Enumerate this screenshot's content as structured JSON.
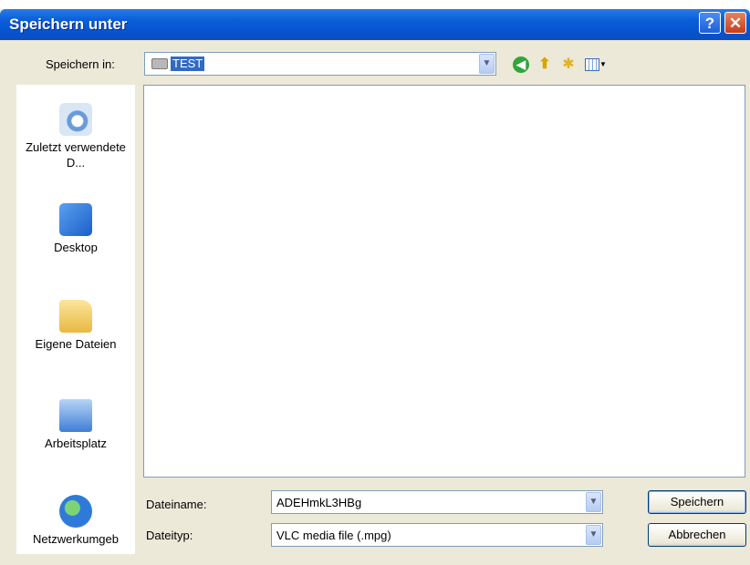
{
  "window": {
    "title": "Speichern unter",
    "help_label": "?",
    "close_label": "✕"
  },
  "toolbar": {
    "look_in_label": "Speichern in:",
    "look_in_value": "TEST",
    "icons": [
      "back-icon",
      "up-folder-icon",
      "new-folder-icon",
      "views-menu-icon"
    ]
  },
  "places": [
    {
      "label": "Zuletzt verwendete D...",
      "icon": "recent-documents-icon"
    },
    {
      "label": "Desktop",
      "icon": "desktop-icon"
    },
    {
      "label": "Eigene Dateien",
      "icon": "my-documents-icon"
    },
    {
      "label": "Arbeitsplatz",
      "icon": "my-computer-icon"
    },
    {
      "label": "Netzwerkumgeb",
      "icon": "network-icon"
    }
  ],
  "form": {
    "filename_label": "Dateiname:",
    "filename_value": "ADEHmkL3HBg",
    "filetype_label": "Dateityp:",
    "filetype_value": "VLC media file (.mpg)"
  },
  "buttons": {
    "save": "Speichern",
    "cancel": "Abbrechen"
  },
  "colors": {
    "titlebar": "#0a5fd8",
    "selection": "#316ac5",
    "dialog_bg": "#ece9d8"
  }
}
